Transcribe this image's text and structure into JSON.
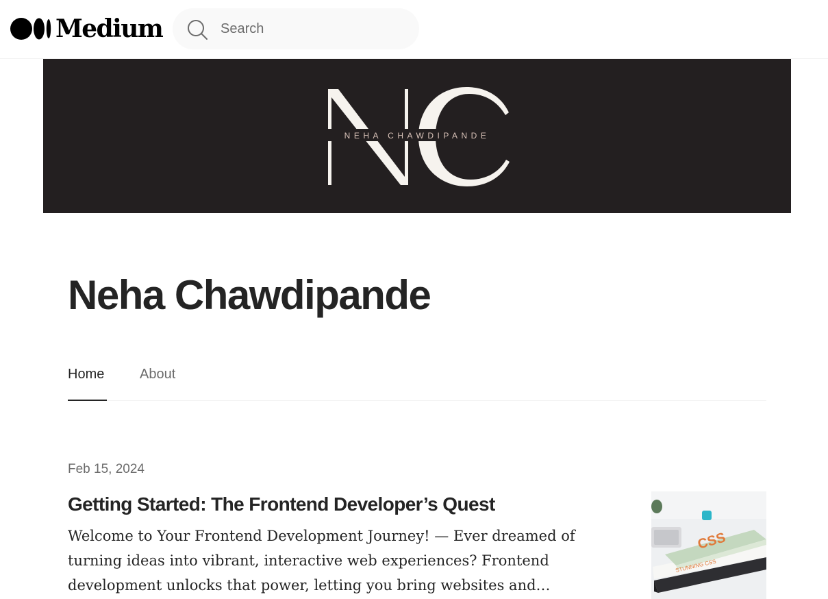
{
  "header": {
    "logo_text": "Medium",
    "search": {
      "placeholder": "Search"
    }
  },
  "banner": {
    "monogram": "NC",
    "subtitle": "NEHA CHAWDIPANDE"
  },
  "author": {
    "name": "Neha Chawdipande"
  },
  "tabs": [
    {
      "label": "Home",
      "active": true
    },
    {
      "label": "About",
      "active": false
    }
  ],
  "post": {
    "date": "Feb 15, 2024",
    "title": "Getting Started: The Frontend Developer’s Quest",
    "excerpt": "Welcome to Your Frontend Development Journey! — Ever dreamed of turning ideas into vibrant, interactive web experiences? Frontend development unlocks that power, letting you bring websites and…",
    "thumbnail_icon": "books-photo",
    "thumbnail_text": {
      "book_title": "CSS",
      "book_spine": "STUNNING CSS"
    }
  },
  "colors": {
    "banner_bg": "#231f20",
    "banner_text": "#f6f3ee",
    "text_primary": "#242424",
    "text_secondary": "#6b6b6b"
  }
}
